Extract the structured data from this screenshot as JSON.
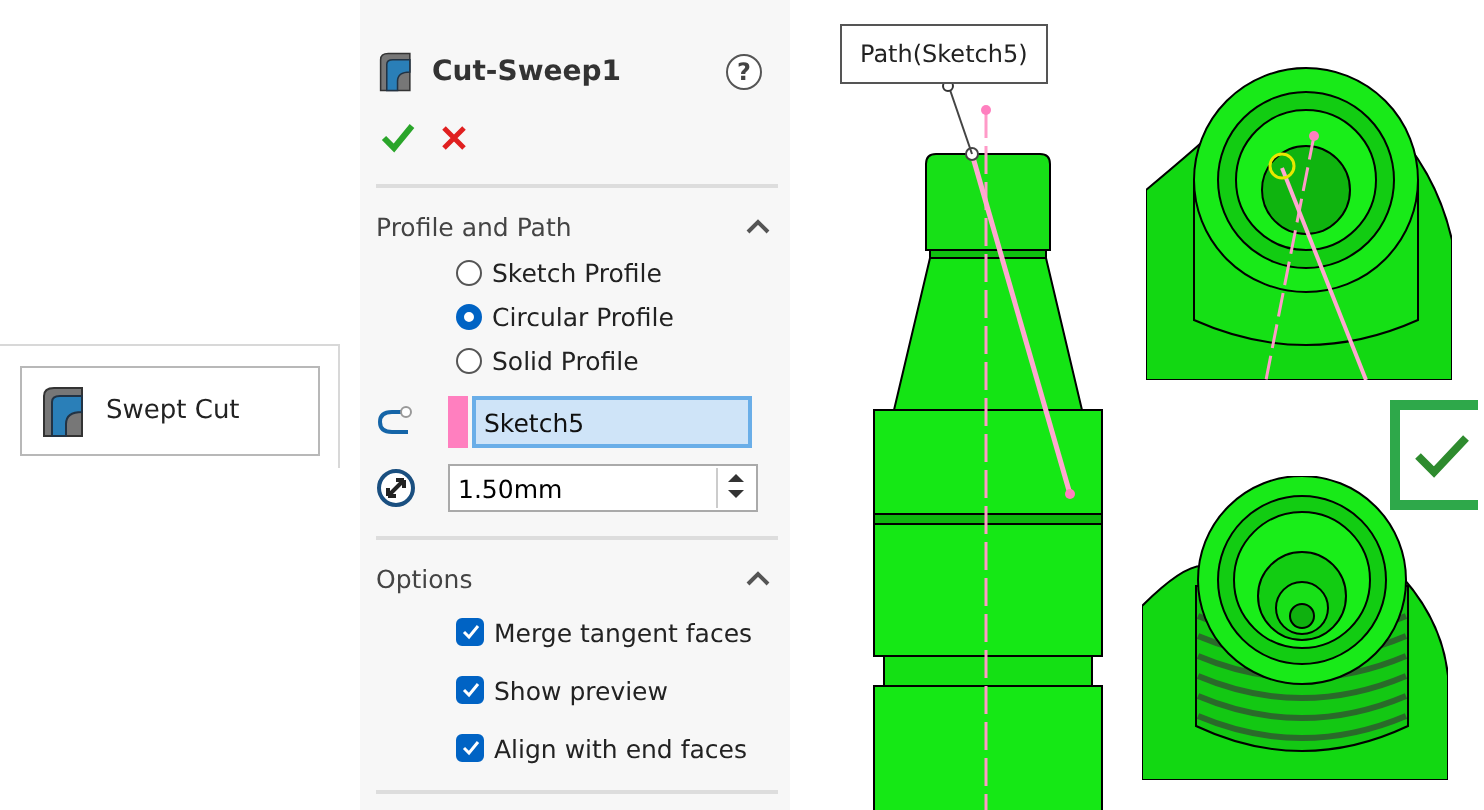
{
  "toolbar_button": {
    "label": "Swept Cut"
  },
  "panel": {
    "title": "Cut-Sweep1",
    "help": "?",
    "profile_section": {
      "title": "Profile and Path",
      "expanded": true,
      "profile_options": [
        {
          "label": "Sketch Profile",
          "selected": false
        },
        {
          "label": "Circular Profile",
          "selected": true
        },
        {
          "label": "Solid Profile",
          "selected": false
        }
      ],
      "path_field": {
        "value": "Sketch5",
        "color": "#ff7fbf"
      },
      "diameter_field": {
        "value": "1.50mm"
      }
    },
    "options_section": {
      "title": "Options",
      "expanded": true,
      "options": [
        {
          "label": "Merge tangent faces",
          "checked": true
        },
        {
          "label": "Show preview",
          "checked": true
        },
        {
          "label": "Align with end faces",
          "checked": true
        }
      ]
    }
  },
  "viewport": {
    "path_label": "Path(Sketch5)"
  }
}
